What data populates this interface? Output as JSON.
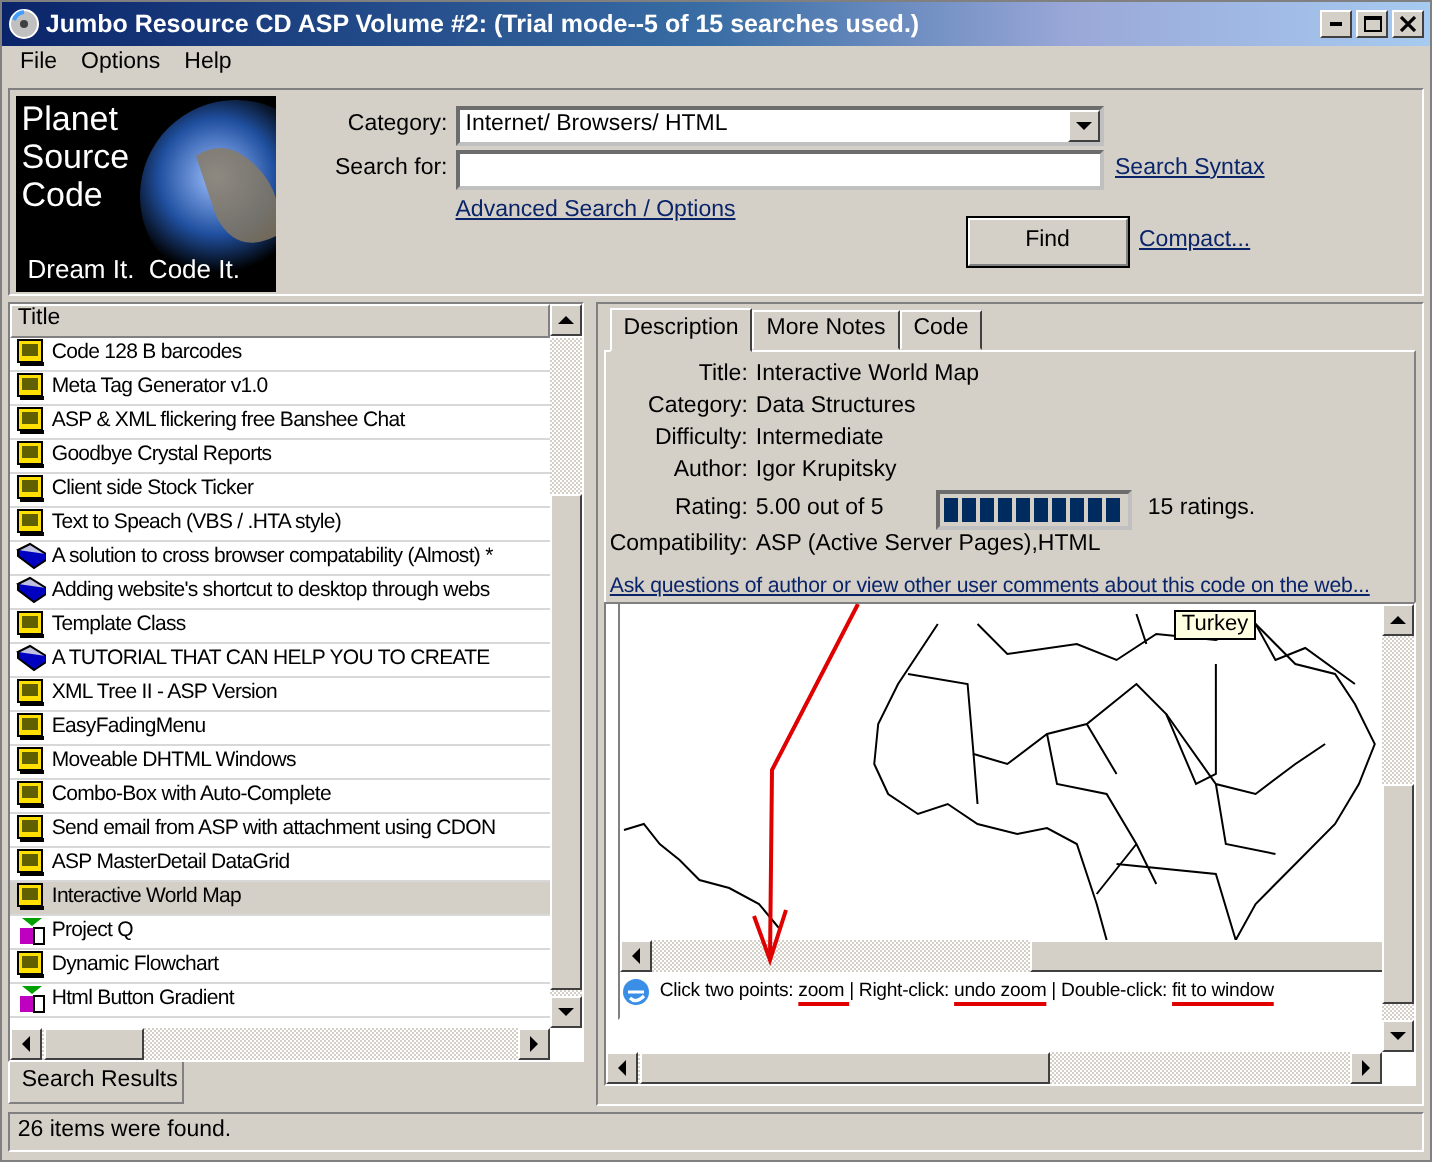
{
  "window": {
    "title": "Jumbo Resource CD ASP Volume #2: (Trial mode--5 of 15 searches used.)"
  },
  "menu": [
    "File",
    "Options",
    "Help"
  ],
  "logo": {
    "lines": [
      "Planet",
      "Source",
      "Code"
    ],
    "tagline": "Dream It.  Code It."
  },
  "search": {
    "category_label": "Category:",
    "category_value": "Internet/ Browsers/ HTML",
    "search_label": "Search for:",
    "syntax_link": "Search Syntax",
    "advanced_link": "Advanced Search / Options",
    "find_button": "Find",
    "compact_link": "Compact..."
  },
  "results": {
    "column": "Title",
    "rows": [
      {
        "kind": "script",
        "title": "Code 128 B barcodes",
        "selected": false
      },
      {
        "kind": "script",
        "title": "Meta Tag Generator v1.0",
        "selected": false
      },
      {
        "kind": "script",
        "title": "ASP & XML flickering free Banshee Chat",
        "selected": false
      },
      {
        "kind": "script",
        "title": "Goodbye Crystal Reports",
        "selected": false
      },
      {
        "kind": "script",
        "title": "Client side Stock Ticker",
        "selected": false
      },
      {
        "kind": "script",
        "title": "Text to Speach (VBS / .HTA style)",
        "selected": false
      },
      {
        "kind": "book",
        "title": "A solution to cross browser compatability (Almost) *",
        "selected": false
      },
      {
        "kind": "book",
        "title": "Adding website's shortcut to desktop through webs",
        "selected": false
      },
      {
        "kind": "script",
        "title": "Template Class",
        "selected": false
      },
      {
        "kind": "book",
        "title": "A TUTORIAL THAT CAN HELP YOU TO CREATE",
        "selected": false
      },
      {
        "kind": "script",
        "title": "XML Tree II - ASP Version",
        "selected": false
      },
      {
        "kind": "script",
        "title": "EasyFadingMenu",
        "selected": false
      },
      {
        "kind": "script",
        "title": "Moveable DHTML Windows",
        "selected": false
      },
      {
        "kind": "script",
        "title": "Combo-Box with Auto-Complete",
        "selected": false
      },
      {
        "kind": "script",
        "title": "Send email from ASP with attachment using CDON",
        "selected": false
      },
      {
        "kind": "script",
        "title": "ASP MasterDetail DataGrid",
        "selected": false
      },
      {
        "kind": "script",
        "title": "Interactive World Map",
        "selected": true
      },
      {
        "kind": "tool",
        "title": "Project Q",
        "selected": false
      },
      {
        "kind": "script",
        "title": "Dynamic Flowchart",
        "selected": false
      },
      {
        "kind": "tool",
        "title": "Html Button Gradient",
        "selected": false
      }
    ],
    "tab": "Search Results"
  },
  "tabs": [
    {
      "label": "Description",
      "selected": true
    },
    {
      "label": "More Notes",
      "selected": false
    },
    {
      "label": "Code",
      "selected": false
    }
  ],
  "details": [
    {
      "label": "Title:",
      "value": "Interactive World Map"
    },
    {
      "label": "Category:",
      "value": "Data Structures"
    },
    {
      "label": "Difficulty:",
      "value": "Intermediate"
    },
    {
      "label": "Author:",
      "value": "Igor Krupitsky"
    },
    {
      "label": "Rating:",
      "value": "5.00 out of 5",
      "level": 1,
      "count": "15 ratings."
    },
    {
      "label": "Compatibility:",
      "value": "ASP (Active Server Pages),HTML"
    }
  ],
  "comments_link": "Ask questions of author or view other user comments about this code on the web...",
  "preview": {
    "tooltip": "Turkey",
    "hint": [
      {
        "text": "Click two points: ",
        "underlined": false
      },
      {
        "text": "zoom ",
        "underlined": true
      },
      {
        "text": "| Right-click: ",
        "underlined": false
      },
      {
        "text": "undo zoom",
        "underlined": true
      },
      {
        "text": " | Double-click: ",
        "underlined": false
      },
      {
        "text": "fit to window",
        "underlined": true
      }
    ]
  },
  "status_bar": "26 items were found."
}
